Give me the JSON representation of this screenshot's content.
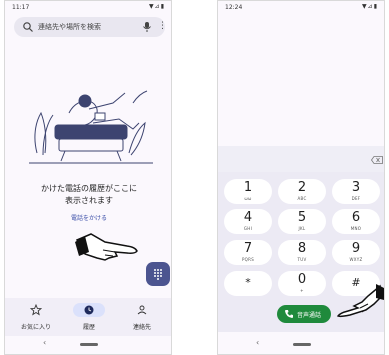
{
  "left_screen": {
    "status_time": "11:17",
    "status_icons": "▼⊿▮",
    "search_placeholder": "連絡先や場所を検索",
    "empty_message_line1": "かけた電話の履歴がここに",
    "empty_message_line2": "表示されます",
    "make_call_link": "電話をかける",
    "nav_items": [
      {
        "label": "お気に入り",
        "icon": "star-icon"
      },
      {
        "label": "履歴",
        "icon": "clock-icon",
        "selected": true
      },
      {
        "label": "連絡先",
        "icon": "people-icon"
      }
    ],
    "accent_color": "#4c5590"
  },
  "right_screen": {
    "status_time": "12:24",
    "status_icons": "▼⊿▮",
    "keys": [
      {
        "digit": "1",
        "letters": "ωω"
      },
      {
        "digit": "2",
        "letters": "ABC"
      },
      {
        "digit": "3",
        "letters": "DEF"
      },
      {
        "digit": "4",
        "letters": "GHI"
      },
      {
        "digit": "5",
        "letters": "JKL"
      },
      {
        "digit": "6",
        "letters": "MNO"
      },
      {
        "digit": "7",
        "letters": "PQRS"
      },
      {
        "digit": "8",
        "letters": "TUV"
      },
      {
        "digit": "9",
        "letters": "WXYZ"
      },
      {
        "digit": "*",
        "letters": ""
      },
      {
        "digit": "0",
        "letters": "+"
      },
      {
        "digit": "#",
        "letters": ""
      }
    ],
    "call_button_label": "音声通話",
    "call_color": "#1f8a3c"
  }
}
